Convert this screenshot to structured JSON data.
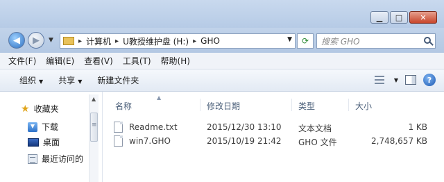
{
  "window": {
    "min_label": "▁",
    "max_label": "□",
    "close_label": "✕"
  },
  "address": {
    "segments": [
      "计算机",
      "U教授维护盘 (H:)",
      "GHO"
    ],
    "separator": "▸"
  },
  "search": {
    "placeholder": "搜索 GHO"
  },
  "menu": [
    "文件(F)",
    "编辑(E)",
    "查看(V)",
    "工具(T)",
    "帮助(H)"
  ],
  "commands": {
    "organize": "组织",
    "share": "共享",
    "new_folder": "新建文件夹"
  },
  "nav_pane": {
    "items": [
      {
        "label": "收藏夹",
        "icon": "star-icon"
      },
      {
        "label": "下载",
        "icon": "download-icon"
      },
      {
        "label": "桌面",
        "icon": "desktop-icon"
      },
      {
        "label": "最近访问的",
        "icon": "recent-places-icon"
      }
    ]
  },
  "columns": {
    "name": "名称",
    "modified": "修改日期",
    "type": "类型",
    "size": "大小"
  },
  "files": [
    {
      "name": "Readme.txt",
      "modified": "2015/12/30 13:10",
      "type": "文本文档",
      "size": "1 KB"
    },
    {
      "name": "win7.GHO",
      "modified": "2015/10/19 21:42",
      "type": "GHO 文件",
      "size": "2,748,657 KB"
    }
  ]
}
